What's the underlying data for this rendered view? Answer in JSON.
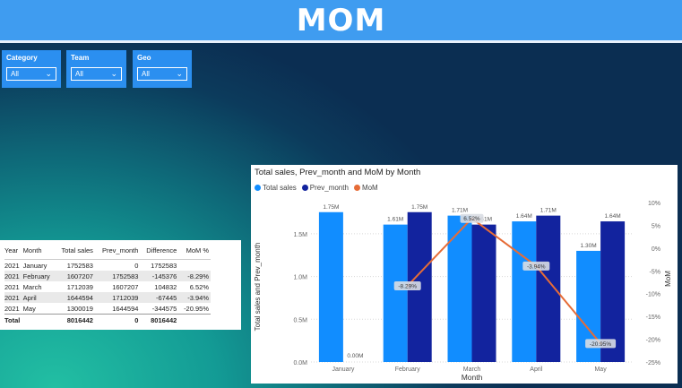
{
  "header": {
    "title": "MOM"
  },
  "slicers": [
    {
      "label": "Category",
      "value": "All"
    },
    {
      "label": "Team",
      "value": "All"
    },
    {
      "label": "Geo",
      "value": "All"
    }
  ],
  "table": {
    "columns": [
      "Year",
      "Month",
      "Total sales",
      "Prev_month",
      "Difference",
      "MoM %"
    ],
    "rows": [
      [
        "2021",
        "January",
        "1752583",
        "0",
        "1752583",
        ""
      ],
      [
        "2021",
        "February",
        "1607207",
        "1752583",
        "-145376",
        "-8.29%"
      ],
      [
        "2021",
        "March",
        "1712039",
        "1607207",
        "104832",
        "6.52%"
      ],
      [
        "2021",
        "April",
        "1644594",
        "1712039",
        "-67445",
        "-3.94%"
      ],
      [
        "2021",
        "May",
        "1300019",
        "1644594",
        "-344575",
        "-20.95%"
      ]
    ],
    "total": [
      "Total",
      "",
      "8016442",
      "0",
      "8016442",
      ""
    ]
  },
  "chart_data": {
    "type": "bar",
    "title": "Total sales, Prev_month and MoM by Month",
    "xlabel": "Month",
    "ylabel": "Total sales and Prev_month",
    "y2label": "MoM",
    "categories": [
      "January",
      "February",
      "March",
      "April",
      "May"
    ],
    "series": [
      {
        "name": "Total sales",
        "kind": "bar",
        "color": "#118dff",
        "values": [
          1752583,
          1607207,
          1712039,
          1644594,
          1300019
        ],
        "labels": [
          "1.75M",
          "1.61M",
          "1.71M",
          "1.64M",
          "1.30M"
        ]
      },
      {
        "name": "Prev_month",
        "kind": "bar",
        "color": "#12239e",
        "values": [
          0,
          1752583,
          1607207,
          1712039,
          1644594
        ],
        "labels": [
          "0.00M",
          "1.75M",
          "1.61M",
          "1.71M",
          "1.64M"
        ]
      },
      {
        "name": "MoM",
        "kind": "line",
        "axis": "secondary",
        "color": "#e66c37",
        "values": [
          null,
          -8.29,
          6.52,
          -3.94,
          -20.95
        ],
        "labels": [
          "",
          "-8.29%",
          "6.52%",
          "-3.94%",
          "-20.95%"
        ]
      }
    ],
    "ylim": [
      0,
      1750000
    ],
    "yticks": [
      0,
      500000,
      1000000,
      1500000
    ],
    "ytick_labels": [
      "0.0M",
      "0.5M",
      "1.0M",
      "1.5M"
    ],
    "y2lim": [
      -25,
      10
    ],
    "y2ticks": [
      10,
      5,
      0,
      -5,
      -10,
      -15,
      -20,
      -25
    ],
    "y2tick_labels": [
      "10%",
      "5%",
      "0%",
      "-5%",
      "-10%",
      "-15%",
      "-20%",
      "-25%"
    ],
    "legend": "top-left",
    "grid": true
  }
}
